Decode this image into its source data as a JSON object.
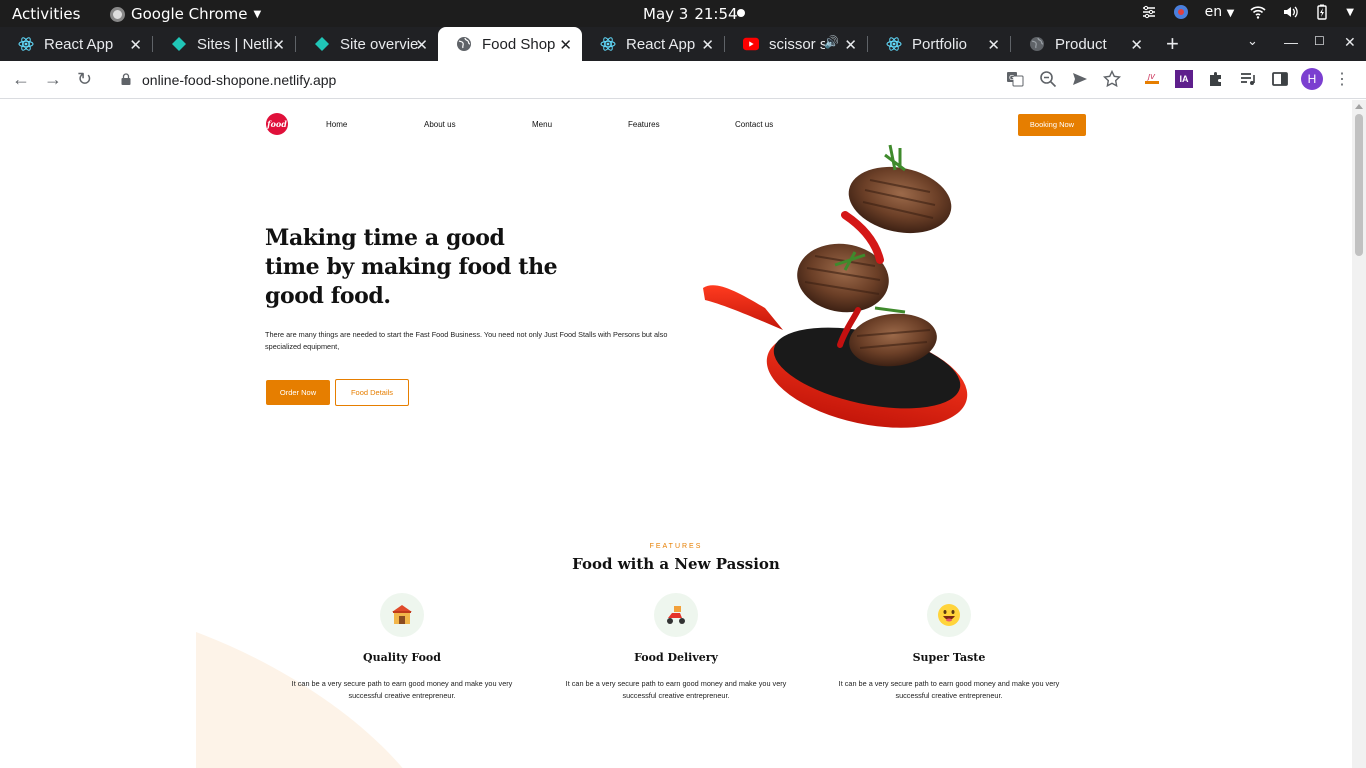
{
  "system_bar": {
    "activities": "Activities",
    "app_name": "Google Chrome",
    "date": "May 3",
    "time": "21:54",
    "language": "en"
  },
  "tabs": [
    {
      "title": "React App",
      "icon": "react-icon",
      "active": false
    },
    {
      "title": "Sites | Netli",
      "icon": "netlify-icon",
      "active": false
    },
    {
      "title": "Site overvie",
      "icon": "netlify-icon",
      "active": false
    },
    {
      "title": "Food Shop",
      "icon": "globe-icon",
      "active": true
    },
    {
      "title": "React App",
      "icon": "react-icon",
      "active": false
    },
    {
      "title": "scissor s",
      "icon": "youtube-icon",
      "active": false
    },
    {
      "title": "Portfolio",
      "icon": "react-icon",
      "active": false
    },
    {
      "title": "Product",
      "icon": "globe-icon",
      "active": false
    }
  ],
  "toolbar": {
    "url": "online-food-shopone.netlify.app",
    "profile_initial": "H",
    "ext_label": "IA"
  },
  "site": {
    "logo_text": "food",
    "nav": [
      "Home",
      "About us",
      "Menu",
      "Features",
      "Contact us"
    ],
    "booking_button": "Booking Now",
    "hero_title": "Making time a good time by making food the good food.",
    "hero_desc": "There are many things are needed to start the Fast Food Business. You need not only Just Food Stalls with Persons but also specialized equipment,",
    "order_button": "Order Now",
    "details_button": "Food Details",
    "features_kicker": "FEATURES",
    "features_title": "Food with a New Passion",
    "features": [
      {
        "name": "Quality Food",
        "icon": "shop-icon",
        "desc": "It can be a very secure path to earn good money and make you very successful creative entrepreneur."
      },
      {
        "name": "Food Delivery",
        "icon": "scooter-icon",
        "desc": "It can be a very secure path to earn good money and make you very successful creative entrepreneur."
      },
      {
        "name": "Super Taste",
        "icon": "smiley-icon",
        "desc": "It can be a very secure path to earn good money and make you very successful creative entrepreneur."
      }
    ]
  },
  "colors": {
    "accent": "#e67e00",
    "logo": "#e0103a",
    "tab_bar": "#202124"
  }
}
